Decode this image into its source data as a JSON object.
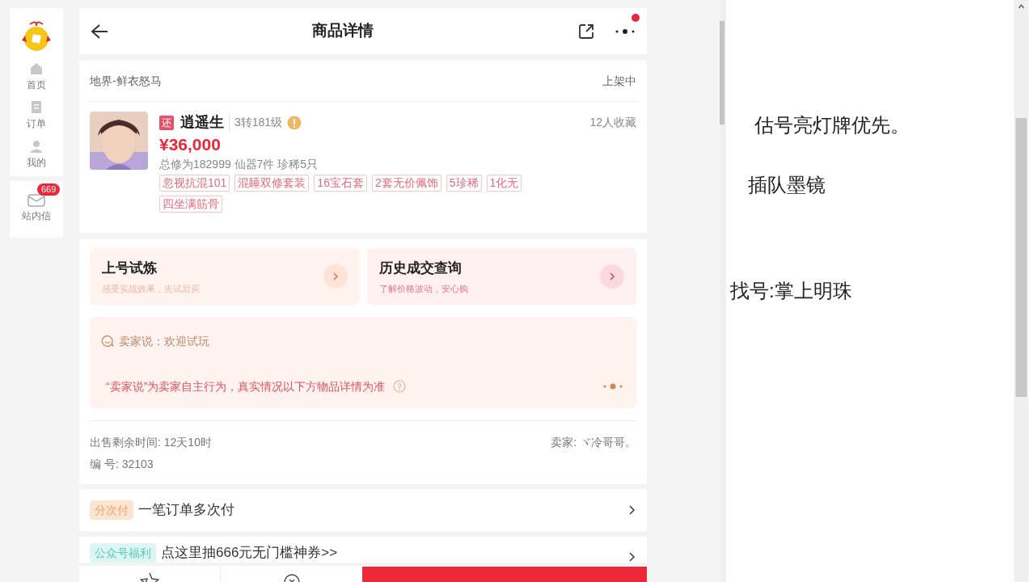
{
  "sidebar": {
    "items": [
      {
        "label": "首页",
        "kind": "home"
      },
      {
        "label": "订单",
        "kind": "order"
      },
      {
        "label": "我的",
        "kind": "user"
      }
    ],
    "messages": {
      "label": "站内信",
      "badge": "669"
    }
  },
  "header": {
    "title": "商品详情",
    "more_dot": true
  },
  "listing": {
    "server": "地界-鲜衣怒马",
    "status": "上架中",
    "role_tag": "还",
    "name": "逍遥生",
    "level": "3转181级",
    "favorites": "12人收藏",
    "price": "¥36,000",
    "stats": "总修为182999 仙器7件 珍稀5只",
    "tags": [
      "忽视抗混101",
      "混睡双修套装",
      "16宝石套",
      "2套无价佩饰",
      "5珍稀",
      "1化无",
      "四坐满筋骨"
    ]
  },
  "actions": [
    {
      "title": "上号试炼",
      "subtitle": "感受实战效果，先试后买",
      "kind": "trial"
    },
    {
      "title": "历史成交查询",
      "subtitle": "了解价格波动，安心购",
      "kind": "history"
    }
  ],
  "seller_note": {
    "text": "卖家说：欢迎试玩",
    "disclaimer": "“卖家说”为卖家自主行为，真实情况以下方物品详情为准"
  },
  "meta": {
    "time_left": "出售剩余时间: 12天10时",
    "seller": "卖家: ヾ冷哥哥。",
    "serial": "编 号: 32103"
  },
  "promos": [
    {
      "tag": "分次付",
      "text": "一笔订单多次付",
      "kind": "pay"
    },
    {
      "tag": "公众号福利",
      "text": "点这里抽666元无门槛神券>>",
      "kind": "coupon"
    }
  ],
  "notes": [
    "估号亮灯牌优先。",
    "插队墨镜",
    "找号:掌上明珠"
  ]
}
